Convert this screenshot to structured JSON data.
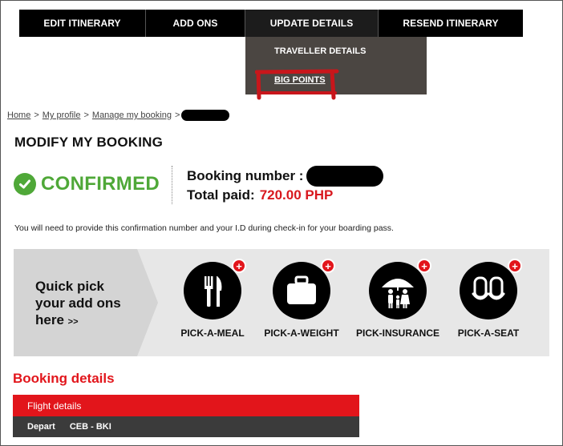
{
  "nav": {
    "items": [
      {
        "label": "EDIT ITINERARY"
      },
      {
        "label": "ADD ONS"
      },
      {
        "label": "UPDATE DETAILS"
      },
      {
        "label": "RESEND ITINERARY"
      }
    ],
    "dropdown": [
      {
        "label": "TRAVELLER DETAILS"
      },
      {
        "label": "BIG POINTS"
      }
    ]
  },
  "breadcrumb": {
    "items": [
      "Home",
      "My profile",
      "Manage my booking"
    ],
    "separator": ">"
  },
  "page_title": "MODIFY MY BOOKING",
  "status": {
    "label": "CONFIRMED",
    "color": "#4fa838"
  },
  "booking": {
    "number_label": "Booking number :",
    "total_label": "Total paid:",
    "total_value": "720.00 PHP",
    "total_color": "#d8181e"
  },
  "notice": "You will need to provide this confirmation number and your I.D during check-in for your boarding pass.",
  "addons": {
    "headline_lines": [
      "Quick pick",
      "your add ons",
      "here"
    ],
    "arrow": ">>",
    "items": [
      {
        "label": "PICK-A-MEAL",
        "icon": "fork-knife-icon"
      },
      {
        "label": "PICK-A-WEIGHT",
        "icon": "luggage-icon"
      },
      {
        "label": "PICK-INSURANCE",
        "icon": "family-umbrella-icon"
      },
      {
        "label": "PICK-A-SEAT",
        "icon": "seat-icon"
      }
    ],
    "badge": "+"
  },
  "booking_details": {
    "title": "Booking details",
    "flight_header": "Flight details",
    "depart_label": "Depart",
    "route": "CEB - BKI"
  },
  "colors": {
    "accent_red": "#e2151b",
    "nav_bg": "#000000",
    "dropdown_bg": "#4b4642"
  }
}
